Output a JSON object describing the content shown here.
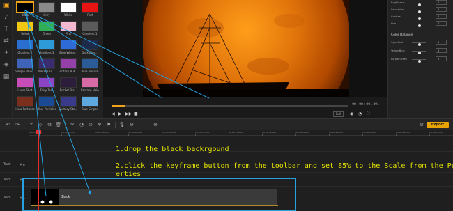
{
  "left_icons": [
    "media-icon",
    "audio-icon",
    "titles-icon",
    "transitions-icon",
    "effects-icon",
    "elements-icon",
    "split-screen-icon"
  ],
  "media": {
    "items": [
      {
        "label": "Black",
        "color": "#000000",
        "selected": true
      },
      {
        "label": "Grey",
        "color": "#8a8a8a"
      },
      {
        "label": "White",
        "color": "#ffffff"
      },
      {
        "label": "Red",
        "color": "#e81414"
      },
      {
        "label": "Yellow",
        "color": "#f2c812"
      },
      {
        "label": "Green",
        "color": "#2fae55"
      },
      {
        "label": "Pink",
        "color": "#f3b7cf"
      },
      {
        "label": "Gradient 1",
        "color": "#5a5a5a"
      },
      {
        "label": "Gradient 2",
        "color": "#2a6fd0"
      },
      {
        "label": "Gradient 3",
        "color": "#2e9bd9"
      },
      {
        "label": "Blue White...",
        "color": "#2f6bd6"
      },
      {
        "label": "Dark Blue...",
        "color": "#1e2a4a"
      },
      {
        "label": "Simple Blue...",
        "color": "#3e63b8"
      },
      {
        "label": "Meteor Fa...",
        "color": "#3a2c6e"
      },
      {
        "label": "Fantasy Bub...",
        "color": "#9340a8"
      },
      {
        "label": "Blue Texture",
        "color": "#2b5c98"
      },
      {
        "label": "Laser Shot",
        "color": "#c94db8"
      },
      {
        "label": "Fairy Tale",
        "color": "#8a44c4"
      },
      {
        "label": "Rocket Bla...",
        "color": "#2c1e3a"
      },
      {
        "label": "Fantasy Halo",
        "color": "#d86aa6"
      },
      {
        "label": "Halo Particles",
        "color": "#7a2e1c"
      },
      {
        "label": "Blue Particles",
        "color": "#1b4a94"
      },
      {
        "label": "Fantasy Sta...",
        "color": "#3a3a8a"
      },
      {
        "label": "Blue Stripes",
        "color": "#5ea8e0"
      }
    ]
  },
  "player": {
    "time": "00 : 00 : 00 . 391",
    "quality": "Full",
    "controls": [
      "prev-frame",
      "play",
      "next-frame",
      "stop"
    ]
  },
  "properties": {
    "rows": [
      {
        "label": "Brightness",
        "value": "0"
      },
      {
        "label": "Saturation",
        "value": "0"
      },
      {
        "label": "Contrast",
        "value": "0"
      },
      {
        "label": "Hue",
        "value": "0"
      }
    ],
    "color_balance_title": "Color Balance",
    "balance_rows": [
      {
        "label": "Cyan-Red",
        "value": "0"
      },
      {
        "label": "Yellow-Blue",
        "value": "0"
      },
      {
        "label": "Purple-Green",
        "value": "0"
      }
    ]
  },
  "toolbar": {
    "tools": [
      "undo-icon",
      "redo-icon",
      "crop-icon",
      "keyframe-icon",
      "copy-icon",
      "delete-icon",
      "cut-icon",
      "speed-icon",
      "split-icon",
      "freeze-icon",
      "marker-icon",
      "voiceover-icon",
      "zoom-out-icon",
      "zoom-in-icon"
    ],
    "export_label": "Export"
  },
  "timeline": {
    "ruler": [
      "00:00:00.000",
      "00:00:02.000",
      "00:00:04.000",
      "00:00:06.000",
      "00:00:08.000",
      "00:00:10.000",
      "00:00:12.000",
      "00:00:14.000",
      "00:00:16.000",
      "00:00:18.000",
      "00:00:20.000",
      "00:00:22.000",
      "00:00:24.000"
    ],
    "tracks": [
      {
        "label": "Track"
      },
      {
        "label": "Track"
      },
      {
        "label": "Track"
      }
    ],
    "clip_label": "Black"
  },
  "instructions": {
    "line1": "1.drop the black backrgound",
    "line2a": "2.click the keyframe button from the toolbar and set 85% to the Scale from the Prop",
    "line2b": "erties"
  },
  "colors": {
    "accent": "#f0a21a",
    "export": "#e8a300",
    "highlight": "#27a2e0",
    "playhead": "#e03030",
    "note_text": "#e6e600"
  }
}
